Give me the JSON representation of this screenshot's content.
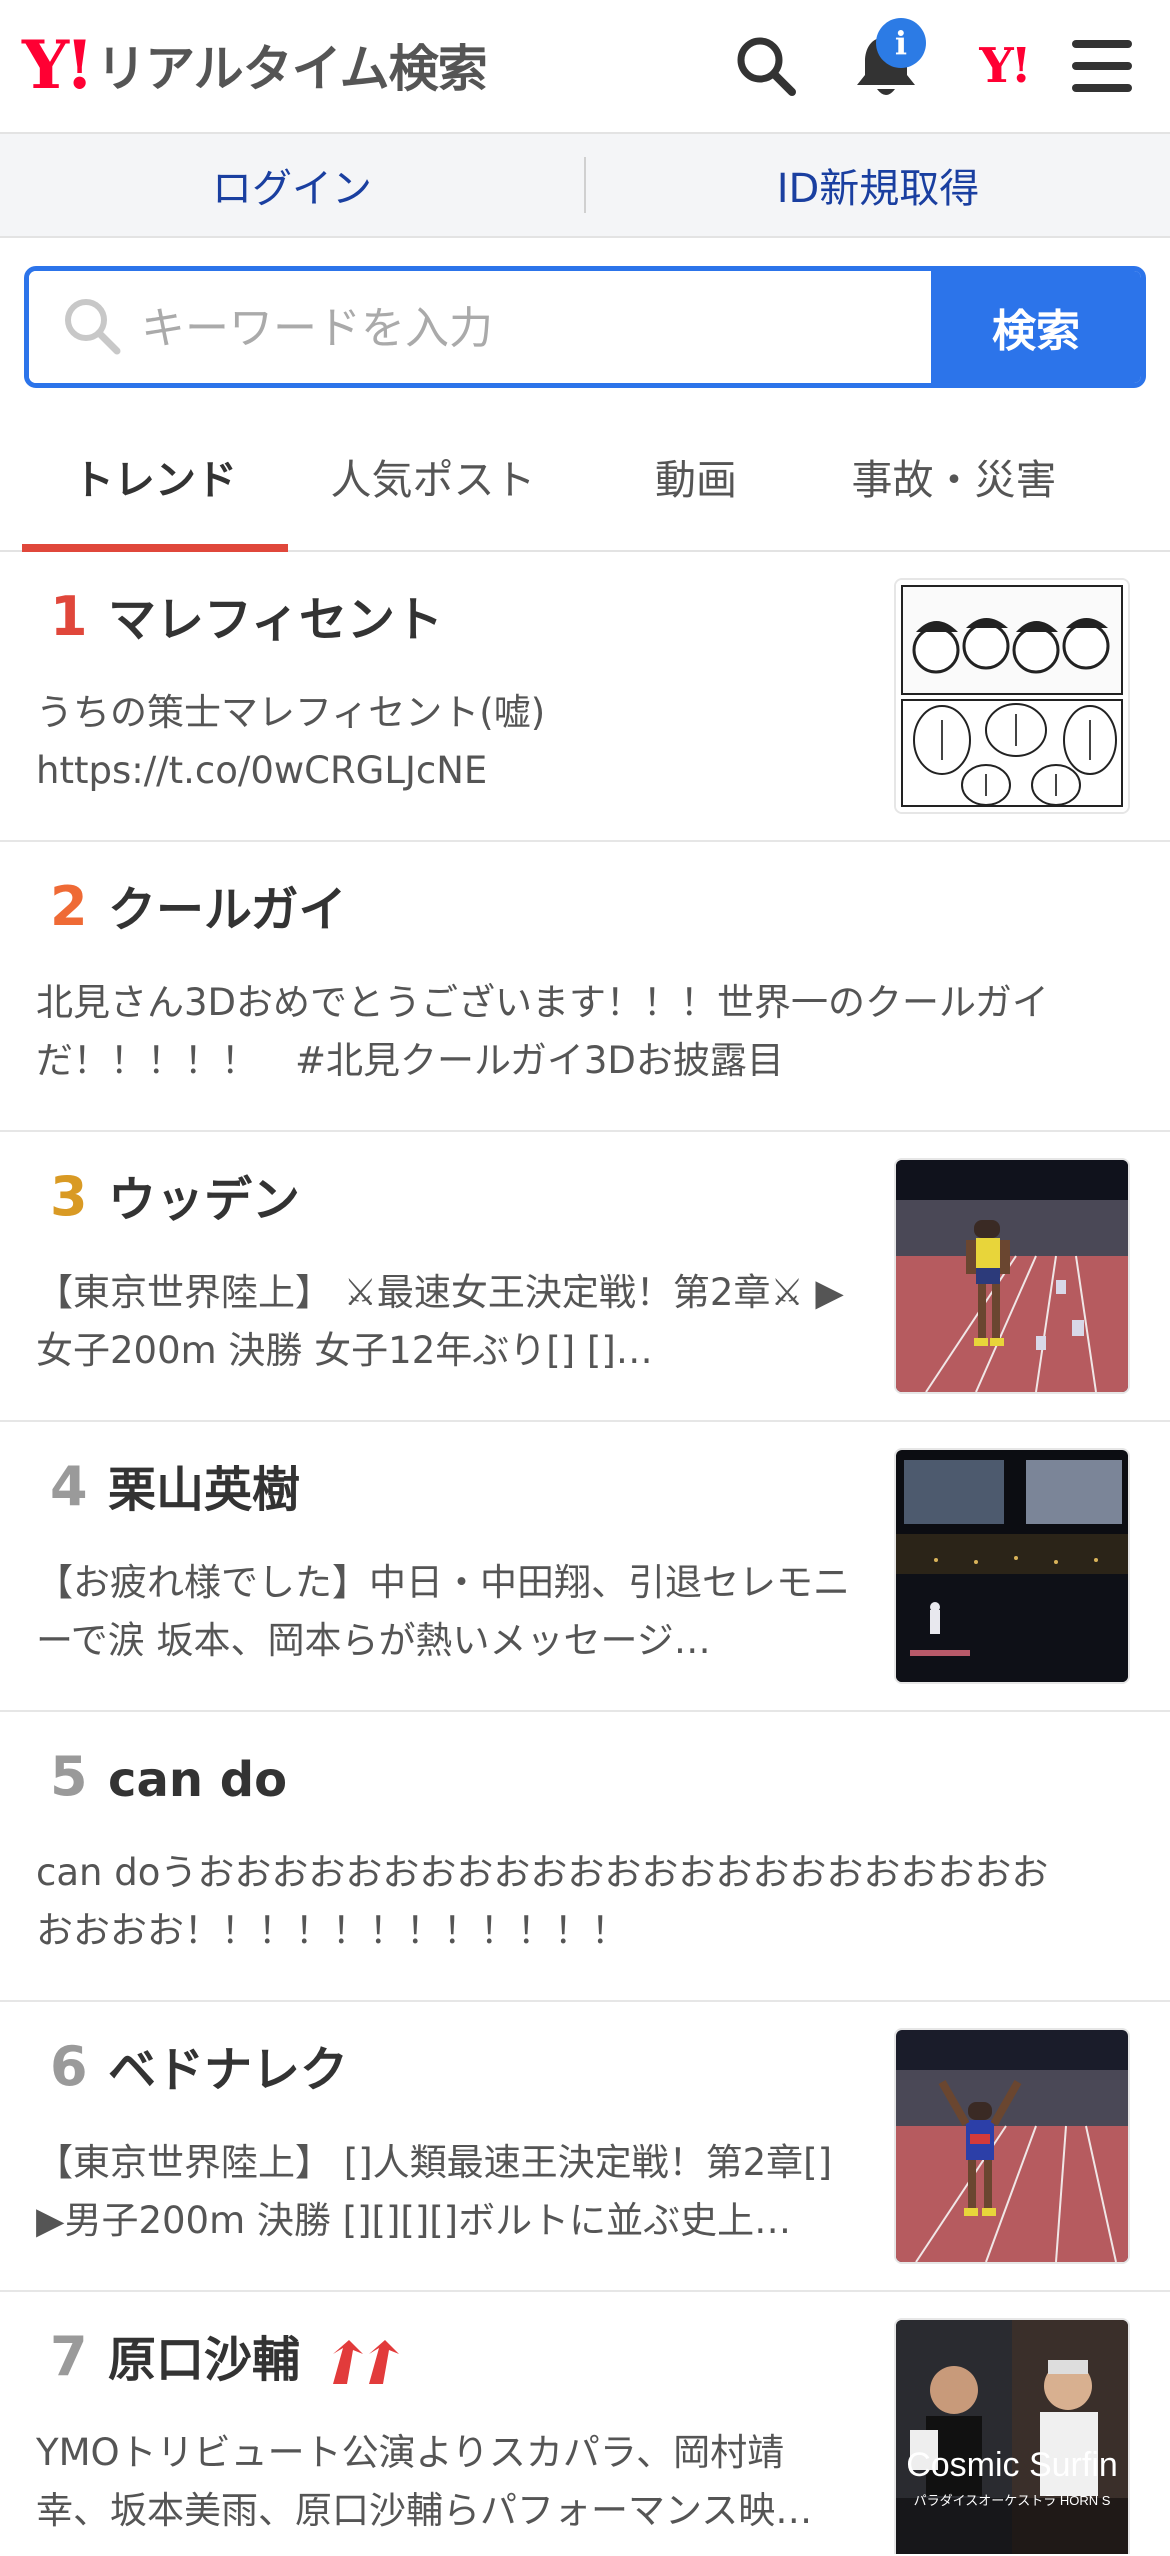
{
  "header": {
    "logo_mark": "Y!",
    "logo_text": "リアルタイム検索",
    "notification_badge": "i",
    "yahoo_mini": "Y!"
  },
  "login": {
    "login_label": "ログイン",
    "signup_label": "ID新規取得"
  },
  "search": {
    "placeholder": "キーワードを入力",
    "value": "",
    "button_label": "検索"
  },
  "tabs": [
    {
      "label": "トレンド",
      "active": true
    },
    {
      "label": "人気ポスト",
      "active": false
    },
    {
      "label": "動画",
      "active": false
    },
    {
      "label": "事故・災害",
      "active": false
    }
  ],
  "colors": {
    "rank1": "#e0473b",
    "rank2": "#ef6a35",
    "rank3": "#d99a24",
    "rank_other": "#9a9a9a",
    "accent_blue": "#2c74ea",
    "brand_red": "#ff0033",
    "rising_arrow": "#e23b3b"
  },
  "trends": [
    {
      "rank": "1",
      "keyword": "マレフィセント",
      "desc": "うちの策士マレフィセント(嘘)\nhttps://t.co/0wCRGLJcNE",
      "thumb": "manga",
      "rising": false
    },
    {
      "rank": "2",
      "keyword": "クールガイ",
      "desc": "北見さん3Dおめでとうございます！！！世界一のクールガイだ！！！！！　#北見クールガイ3Dお披露目",
      "thumb": "",
      "rising": false
    },
    {
      "rank": "3",
      "keyword": "ウッデン",
      "desc": "【東京世界陸上】 ⚔最速女王決定戦！第2章⚔ ▶女子200m 決勝 女子12年ぶり[] []…",
      "thumb": "track-runner",
      "rising": false
    },
    {
      "rank": "4",
      "keyword": "栗山英樹",
      "desc": "【お疲れ様でした】中日・中田翔、引退セレモニーで涙 坂本、岡本らが熱いメッセージ…",
      "thumb": "stadium-night",
      "rising": false
    },
    {
      "rank": "5",
      "keyword": "can do",
      "desc": "can doうおおおおおおおおおおおおおおおおおおおおおおおおおおお！！！！！！！！！！！！",
      "thumb": "",
      "rising": false
    },
    {
      "rank": "6",
      "keyword": "ベドナレク",
      "desc": "【東京世界陸上】 []人類最速王決定戦！第2章[] ▶男子200m 決勝 [][][][]ボルトに並ぶ史上…",
      "thumb": "track-usa",
      "rising": false
    },
    {
      "rank": "7",
      "keyword": "原口沙輔",
      "desc": "YMOトリビュート公演よりスカパラ、岡村靖幸、坂本美雨、原口沙輔らパフォーマンス映…",
      "thumb": "concert",
      "rising": true,
      "thumb_text": "Cosmic Surfin",
      "thumb_subtext": "パラダイスオーケストラ HORN S"
    }
  ]
}
